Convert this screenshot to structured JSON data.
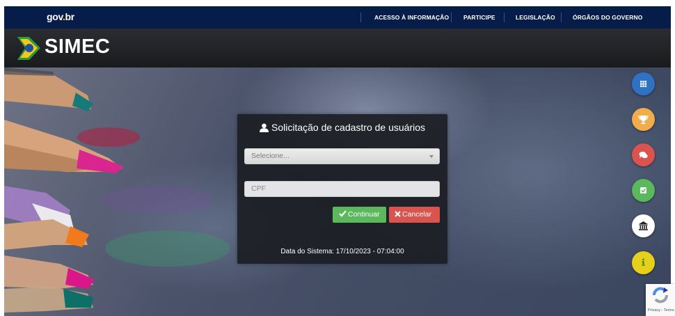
{
  "header": {
    "gov_logo": {
      "name": "gov",
      "dot": ".",
      "tld": "br"
    },
    "links": [
      {
        "label": "ACESSO À INFORMAÇÃO"
      },
      {
        "label": "PARTICIPE"
      },
      {
        "label": "LEGISLAÇÃO"
      },
      {
        "label": "ÓRGÃOS DO GOVERNO"
      }
    ],
    "bg_color": "#071d49"
  },
  "brand": {
    "title": "SIMEC"
  },
  "login_panel": {
    "title": "Solicitação de cadastro de usuários",
    "select": {
      "value": "Selecione..."
    },
    "cpf": {
      "placeholder": "CPF"
    },
    "continue_label": "Continuar",
    "cancel_label": "Cancelar",
    "system_date": "Data do Sistema: 17/10/2023 - 07:04:00"
  },
  "side_buttons": [
    {
      "icon": "grid-icon",
      "color": "#2f72c4"
    },
    {
      "icon": "trophy-icon",
      "color": "#f0ad4e"
    },
    {
      "icon": "chat-icon",
      "color": "#d9534f"
    },
    {
      "icon": "checkbox-icon",
      "color": "#5cb85c"
    },
    {
      "icon": "institution-icon",
      "color": "#ffffff"
    },
    {
      "icon": "info-icon",
      "color": "#e6d01b"
    }
  ],
  "recaptcha": {
    "text": "Privacy - Terms"
  }
}
